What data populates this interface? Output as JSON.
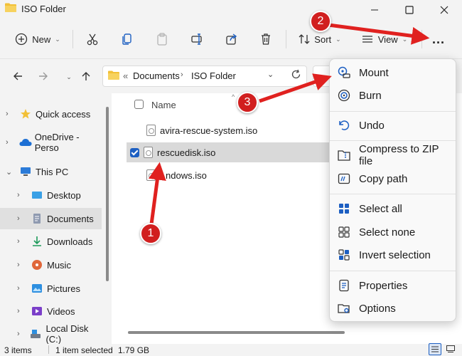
{
  "window": {
    "title": "ISO Folder"
  },
  "toolbar": {
    "new_label": "New",
    "sort_label": "Sort",
    "view_label": "View",
    "more_label": "..."
  },
  "address": {
    "prefix": "«",
    "crumbs": [
      "Documents",
      "ISO Folder"
    ]
  },
  "sidebar": {
    "items": [
      {
        "label": "Quick access",
        "icon": "star-icon"
      },
      {
        "label": "OneDrive - Perso",
        "icon": "cloud-icon"
      },
      {
        "label": "This PC",
        "icon": "pc-icon"
      },
      {
        "label": "Desktop",
        "icon": "desktop-icon"
      },
      {
        "label": "Documents",
        "icon": "documents-icon"
      },
      {
        "label": "Downloads",
        "icon": "downloads-icon"
      },
      {
        "label": "Music",
        "icon": "music-icon"
      },
      {
        "label": "Pictures",
        "icon": "pictures-icon"
      },
      {
        "label": "Videos",
        "icon": "videos-icon"
      },
      {
        "label": "Local Disk (C:)",
        "icon": "disk-icon"
      }
    ]
  },
  "files": {
    "column_name": "Name",
    "rows": [
      {
        "name": "avira-rescue-system.iso",
        "selected": false
      },
      {
        "name": "rescuedisk.iso",
        "selected": true
      },
      {
        "name": "ndows.iso",
        "selected": false
      }
    ]
  },
  "context_menu": {
    "items": [
      {
        "label": "Mount",
        "icon": "mount-icon"
      },
      {
        "label": "Burn",
        "icon": "burn-icon"
      },
      {
        "label": "Undo",
        "icon": "undo-icon"
      },
      {
        "label": "Compress to ZIP file",
        "icon": "zip-icon"
      },
      {
        "label": "Copy path",
        "icon": "copy-path-icon"
      },
      {
        "label": "Select all",
        "icon": "select-all-icon"
      },
      {
        "label": "Select none",
        "icon": "select-none-icon"
      },
      {
        "label": "Invert selection",
        "icon": "invert-selection-icon"
      },
      {
        "label": "Properties",
        "icon": "properties-icon"
      },
      {
        "label": "Options",
        "icon": "options-icon"
      }
    ]
  },
  "status": {
    "item_count": "3 items",
    "selection": "1 item selected",
    "size": "1.79 GB"
  },
  "annotations": {
    "badge1": "1",
    "badge2": "2",
    "badge3": "3"
  },
  "colors": {
    "accent": "#1d5fc2",
    "annotation_red": "#d11f1f",
    "folder": "#f2c037"
  }
}
